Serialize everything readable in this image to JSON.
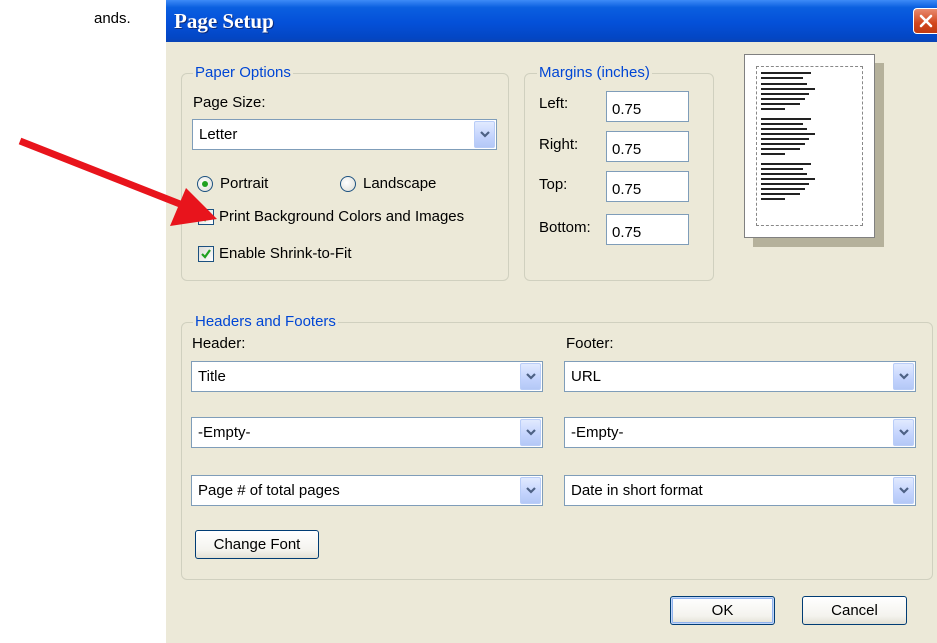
{
  "background_fragment": "ands.",
  "dialog": {
    "title": "Page Setup",
    "paper_options": {
      "legend": "Paper Options",
      "page_size_label": "Page Size:",
      "page_size_value": "Letter",
      "orientation": {
        "portrait_label": "Portrait",
        "landscape_label": "Landscape",
        "selected": "Portrait"
      },
      "print_background_label": "Print Background Colors and Images",
      "print_background_checked": true,
      "shrink_to_fit_label": "Enable Shrink-to-Fit",
      "shrink_to_fit_checked": true
    },
    "margins": {
      "legend": "Margins (inches)",
      "left_label": "Left:",
      "left_value": "0.75",
      "right_label": "Right:",
      "right_value": "0.75",
      "top_label": "Top:",
      "top_value": "0.75",
      "bottom_label": "Bottom:",
      "bottom_value": "0.75"
    },
    "headers_footers": {
      "legend": "Headers and Footers",
      "header_label": "Header:",
      "footer_label": "Footer:",
      "header_values": [
        "Title",
        "-Empty-",
        "Page # of total pages"
      ],
      "footer_values": [
        "URL",
        "-Empty-",
        "Date in short format"
      ],
      "change_font_label": "Change Font"
    },
    "ok_label": "OK",
    "cancel_label": "Cancel"
  },
  "colors": {
    "dialog_bg": "#ece9d8",
    "titlebar": "#0450d8",
    "legend_text": "#0046d5",
    "annotation_arrow": "#e8141c"
  },
  "icons": {
    "close": "close-x-icon",
    "dropdown": "chevron-down-icon",
    "arrow": "annotation-arrow"
  }
}
